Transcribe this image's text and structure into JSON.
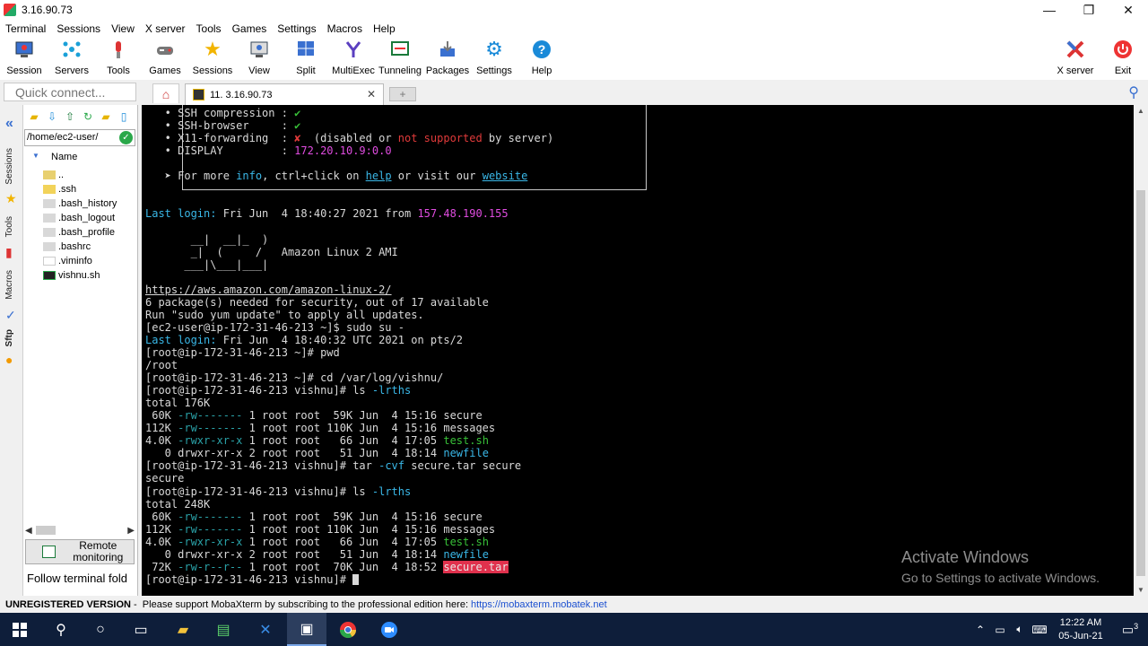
{
  "window": {
    "title": "3.16.90.73"
  },
  "menu": [
    "Terminal",
    "Sessions",
    "View",
    "X server",
    "Tools",
    "Games",
    "Settings",
    "Macros",
    "Help"
  ],
  "toolbar": {
    "buttons": [
      {
        "label": "Session",
        "icon": "session-icon"
      },
      {
        "label": "Servers",
        "icon": "servers-icon"
      },
      {
        "label": "Tools",
        "icon": "tools-icon"
      },
      {
        "label": "Games",
        "icon": "games-icon"
      },
      {
        "label": "Sessions",
        "icon": "star-icon"
      },
      {
        "label": "View",
        "icon": "view-icon"
      },
      {
        "label": "Split",
        "icon": "split-icon"
      },
      {
        "label": "MultiExec",
        "icon": "multiexec-icon"
      },
      {
        "label": "Tunneling",
        "icon": "tunneling-icon"
      },
      {
        "label": "Packages",
        "icon": "packages-icon"
      },
      {
        "label": "Settings",
        "icon": "settings-icon"
      },
      {
        "label": "Help",
        "icon": "help-icon"
      }
    ],
    "right_buttons": [
      {
        "label": "X server",
        "icon": "xserver-icon"
      },
      {
        "label": "Exit",
        "icon": "exit-icon"
      }
    ]
  },
  "quick_connect": {
    "placeholder": "Quick connect..."
  },
  "tabs": {
    "session_tab": "11. 3.16.90.73"
  },
  "side_tabs": [
    "Sessions",
    "Tools",
    "Macros",
    "Sftp"
  ],
  "sftp": {
    "path": "/home/ec2-user/",
    "column": "Name",
    "files": [
      {
        "name": "..",
        "type": "folder-up"
      },
      {
        "name": ".ssh",
        "type": "folder"
      },
      {
        "name": ".bash_history",
        "type": "file"
      },
      {
        "name": ".bash_logout",
        "type": "file"
      },
      {
        "name": ".bash_profile",
        "type": "file"
      },
      {
        "name": ".bashrc",
        "type": "file"
      },
      {
        "name": ".viminfo",
        "type": "file"
      },
      {
        "name": "vishnu.sh",
        "type": "script"
      }
    ],
    "remote_monitoring": "Remote monitoring",
    "follow": "Follow terminal fold"
  },
  "terminal": {
    "lines": [
      [
        {
          "t": "   • SSH compression : "
        },
        {
          "t": "✔",
          "c": "c-green"
        }
      ],
      [
        {
          "t": "   • SSH-browser     : "
        },
        {
          "t": "✔",
          "c": "c-green"
        }
      ],
      [
        {
          "t": "   • X11-forwarding  : "
        },
        {
          "t": "✘",
          "c": "c-red"
        },
        {
          "t": "  (disabled or "
        },
        {
          "t": "not supported",
          "c": "c-red"
        },
        {
          "t": " by server)"
        }
      ],
      [
        {
          "t": "   • DISPLAY         : "
        },
        {
          "t": "172.20.10.9:0.0",
          "c": "c-mag"
        }
      ],
      [
        {
          "t": ""
        }
      ],
      [
        {
          "t": "   ➤ For more "
        },
        {
          "t": "info",
          "c": "c-cyan"
        },
        {
          "t": ", ctrl+click on "
        },
        {
          "t": "help",
          "c": "c-link"
        },
        {
          "t": " or visit our "
        },
        {
          "t": "website",
          "c": "c-link"
        }
      ],
      [
        {
          "t": ""
        }
      ],
      [
        {
          "t": ""
        }
      ],
      [
        {
          "t": "Last login:",
          "c": "c-cyan"
        },
        {
          "t": " Fri Jun  4 18:40:27 2021 from "
        },
        {
          "t": "157.48.190.155",
          "c": "c-mag"
        }
      ],
      [
        {
          "t": ""
        }
      ],
      [
        {
          "t": "       __|  __|_  )"
        }
      ],
      [
        {
          "t": "       _|  (     /   Amazon Linux 2 AMI"
        }
      ],
      [
        {
          "t": "      ___|\\___|___|"
        }
      ],
      [
        {
          "t": ""
        }
      ],
      [
        {
          "t": "https://aws.amazon.com/amazon-linux-2/",
          "c": "c-u"
        }
      ],
      [
        {
          "t": "6 package(s) needed for security, out of 17 available"
        }
      ],
      [
        {
          "t": "Run \"sudo yum update\" to apply all updates."
        }
      ],
      [
        {
          "t": "[ec2-user@ip-172-31-46-213 ~]$ sudo su -"
        }
      ],
      [
        {
          "t": "Last login:",
          "c": "c-cyan"
        },
        {
          "t": " Fri Jun  4 18:40:32 UTC 2021 on pts/2"
        }
      ],
      [
        {
          "t": "[root@ip-172-31-46-213 ~]# pwd"
        }
      ],
      [
        {
          "t": "/root"
        }
      ],
      [
        {
          "t": "[root@ip-172-31-46-213 ~]# cd /var/log/vishnu/"
        }
      ],
      [
        {
          "t": "[root@ip-172-31-46-213 vishnu]# ls "
        },
        {
          "t": "-lrths",
          "c": "c-cyan"
        }
      ],
      [
        {
          "t": "total 176K"
        }
      ],
      [
        {
          "t": " 60K "
        },
        {
          "t": "-rw-------",
          "c": "c-teal"
        },
        {
          "t": " 1 root root  59K Jun  4 15:16 secure"
        }
      ],
      [
        {
          "t": "112K "
        },
        {
          "t": "-rw-------",
          "c": "c-teal"
        },
        {
          "t": " 1 root root 110K Jun  4 15:16 messages"
        }
      ],
      [
        {
          "t": "4.0K "
        },
        {
          "t": "-rwxr-xr-x",
          "c": "c-teal"
        },
        {
          "t": " 1 root root   66 Jun  4 17:05 "
        },
        {
          "t": "test.sh",
          "c": "c-green"
        }
      ],
      [
        {
          "t": "   0 drwxr-xr-x 2 root root   51 Jun  4 18:14 "
        },
        {
          "t": "newfile",
          "c": "c-cyan"
        }
      ],
      [
        {
          "t": "[root@ip-172-31-46-213 vishnu]# tar "
        },
        {
          "t": "-cvf",
          "c": "c-cyan"
        },
        {
          "t": " secure.tar secure"
        }
      ],
      [
        {
          "t": "secure"
        }
      ],
      [
        {
          "t": "[root@ip-172-31-46-213 vishnu]# ls "
        },
        {
          "t": "-lrths",
          "c": "c-cyan"
        }
      ],
      [
        {
          "t": "total 248K"
        }
      ],
      [
        {
          "t": " 60K "
        },
        {
          "t": "-rw-------",
          "c": "c-teal"
        },
        {
          "t": " 1 root root  59K Jun  4 15:16 secure"
        }
      ],
      [
        {
          "t": "112K "
        },
        {
          "t": "-rw-------",
          "c": "c-teal"
        },
        {
          "t": " 1 root root 110K Jun  4 15:16 messages"
        }
      ],
      [
        {
          "t": "4.0K "
        },
        {
          "t": "-rwxr-xr-x",
          "c": "c-teal"
        },
        {
          "t": " 1 root root   66 Jun  4 17:05 "
        },
        {
          "t": "test.sh",
          "c": "c-green"
        }
      ],
      [
        {
          "t": "   0 drwxr-xr-x 2 root root   51 Jun  4 18:14 "
        },
        {
          "t": "newfile",
          "c": "c-cyan"
        }
      ],
      [
        {
          "t": " 72K "
        },
        {
          "t": "-rw-r--r--",
          "c": "c-teal"
        },
        {
          "t": " 1 root root  70K Jun  4 18:52 "
        },
        {
          "t": "secure.tar",
          "c": "hl"
        }
      ],
      [
        {
          "t": "[root@ip-172-31-46-213 vishnu]# "
        },
        {
          "t": "",
          "c": "cursor"
        }
      ]
    ]
  },
  "watermark": {
    "line1": "Activate Windows",
    "line2": "Go to Settings to activate Windows."
  },
  "status": {
    "bold": "UNREGISTERED VERSION",
    "text": " -  Please support MobaXterm by subscribing to the professional edition here:",
    "link": "https://mobaxterm.mobatek.net"
  },
  "taskbar": {
    "apps": [
      "start-icon",
      "search-icon",
      "cortana-icon",
      "task-view-icon",
      "file-explorer-icon",
      "notepad-icon",
      "vscode-icon",
      "mobaxterm-icon",
      "chrome-icon",
      "zoom-icon"
    ],
    "time": "12:22 AM",
    "date": "05-Jun-21",
    "notif_count": "3"
  },
  "colors": {
    "accent": "#3a70d0",
    "terminal_bg": "#000000",
    "highlight": "#e0314d"
  }
}
